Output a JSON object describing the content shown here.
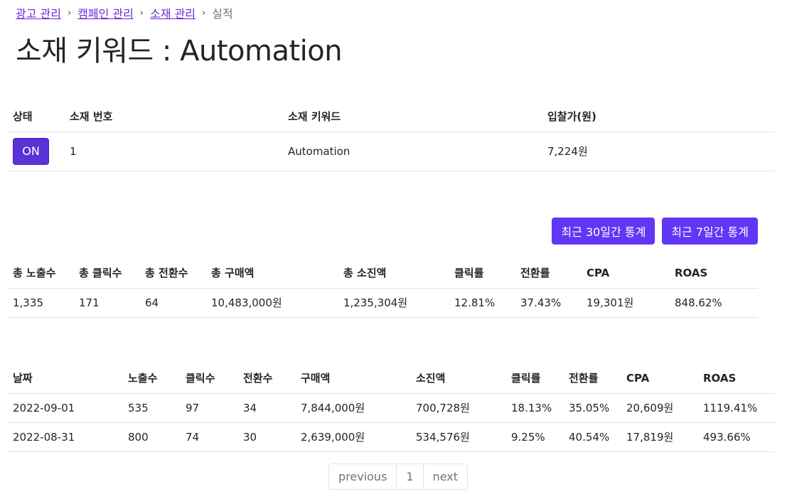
{
  "breadcrumb": {
    "items": [
      "광고 관리",
      "캠페인 관리",
      "소재 관리"
    ],
    "separator": "›",
    "current": "실적"
  },
  "title": "소재 키워드 : Automation",
  "creative_table": {
    "headers": [
      "상태",
      "소재 번호",
      "소재 키워드",
      "입찰가(원)"
    ],
    "row": {
      "status": "ON",
      "number": "1",
      "keyword": "Automation",
      "bid": "7,224원"
    }
  },
  "stats_buttons": {
    "last30": "최근 30일간 통계",
    "last7": "최근 7일간 통계"
  },
  "summary_table": {
    "headers": [
      "총 노출수",
      "총 클릭수",
      "총 전환수",
      "총 구매액",
      "총 소진액",
      "클릭률",
      "전환률",
      "CPA",
      "ROAS"
    ],
    "row": [
      "1,335",
      "171",
      "64",
      "10,483,000원",
      "1,235,304원",
      "12.81%",
      "37.43%",
      "19,301원",
      "848.62%"
    ]
  },
  "daily_table": {
    "headers": [
      "날짜",
      "노출수",
      "클릭수",
      "전환수",
      "구매액",
      "소진액",
      "클릭률",
      "전환률",
      "CPA",
      "ROAS"
    ],
    "rows": [
      [
        "2022-09-01",
        "535",
        "97",
        "34",
        "7,844,000원",
        "700,728원",
        "18.13%",
        "35.05%",
        "20,609원",
        "1119.41%"
      ],
      [
        "2022-08-31",
        "800",
        "74",
        "30",
        "2,639,000원",
        "534,576원",
        "9.25%",
        "40.54%",
        "17,819원",
        "493.66%"
      ]
    ]
  },
  "pagination": {
    "previous": "previous",
    "page": "1",
    "next": "next"
  },
  "colors": {
    "primary": "#6236f5",
    "on_button": "#5b32d6",
    "link": "#6d28d9"
  }
}
